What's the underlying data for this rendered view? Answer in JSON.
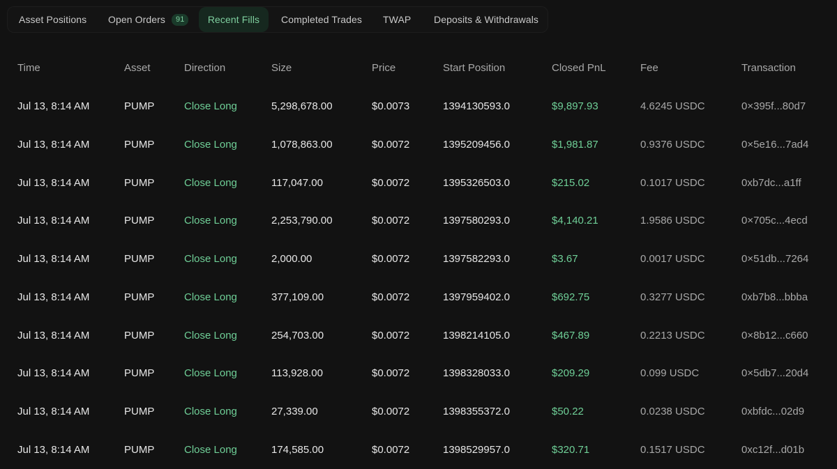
{
  "tabs": [
    {
      "label": "Asset Positions",
      "active": false
    },
    {
      "label": "Open Orders",
      "active": false,
      "badge": "91"
    },
    {
      "label": "Recent Fills",
      "active": true
    },
    {
      "label": "Completed Trades",
      "active": false
    },
    {
      "label": "TWAP",
      "active": false
    },
    {
      "label": "Deposits & Withdrawals",
      "active": false
    }
  ],
  "table": {
    "headers": [
      "Time",
      "Asset",
      "Direction",
      "Size",
      "Price",
      "Start Position",
      "Closed PnL",
      "Fee",
      "Transaction"
    ],
    "rows": [
      [
        "Jul 13, 8:14 AM",
        "PUMP",
        "Close Long",
        "5,298,678.00",
        "$0.0073",
        "1394130593.0",
        "$9,897.93",
        "4.6245 USDC",
        "0×395f...80d7"
      ],
      [
        "Jul 13, 8:14 AM",
        "PUMP",
        "Close Long",
        "1,078,863.00",
        "$0.0072",
        "1395209456.0",
        "$1,981.87",
        "0.9376 USDC",
        "0×5e16...7ad4"
      ],
      [
        "Jul 13, 8:14 AM",
        "PUMP",
        "Close Long",
        "117,047.00",
        "$0.0072",
        "1395326503.0",
        "$215.02",
        "0.1017 USDC",
        "0xb7dc...a1ff"
      ],
      [
        "Jul 13, 8:14 AM",
        "PUMP",
        "Close Long",
        "2,253,790.00",
        "$0.0072",
        "1397580293.0",
        "$4,140.21",
        "1.9586 USDC",
        "0×705c...4ecd"
      ],
      [
        "Jul 13, 8:14 AM",
        "PUMP",
        "Close Long",
        "2,000.00",
        "$0.0072",
        "1397582293.0",
        "$3.67",
        "0.0017 USDC",
        "0×51db...7264"
      ],
      [
        "Jul 13, 8:14 AM",
        "PUMP",
        "Close Long",
        "377,109.00",
        "$0.0072",
        "1397959402.0",
        "$692.75",
        "0.3277 USDC",
        "0xb7b8...bbba"
      ],
      [
        "Jul 13, 8:14 AM",
        "PUMP",
        "Close Long",
        "254,703.00",
        "$0.0072",
        "1398214105.0",
        "$467.89",
        "0.2213 USDC",
        "0×8b12...c660"
      ],
      [
        "Jul 13, 8:14 AM",
        "PUMP",
        "Close Long",
        "113,928.00",
        "$0.0072",
        "1398328033.0",
        "$209.29",
        "0.099 USDC",
        "0×5db7...20d4"
      ],
      [
        "Jul 13, 8:14 AM",
        "PUMP",
        "Close Long",
        "27,339.00",
        "$0.0072",
        "1398355372.0",
        "$50.22",
        "0.0238 USDC",
        "0xbfdc...02d9"
      ],
      [
        "Jul 13, 8:14 AM",
        "PUMP",
        "Close Long",
        "174,585.00",
        "$0.0072",
        "1398529957.0",
        "$320.71",
        "0.1517 USDC",
        "0xc12f...d01b"
      ]
    ]
  },
  "colors": {
    "background": "#121212",
    "accent_green": "#6fcf97",
    "active_tab_bg": "#16281f"
  }
}
